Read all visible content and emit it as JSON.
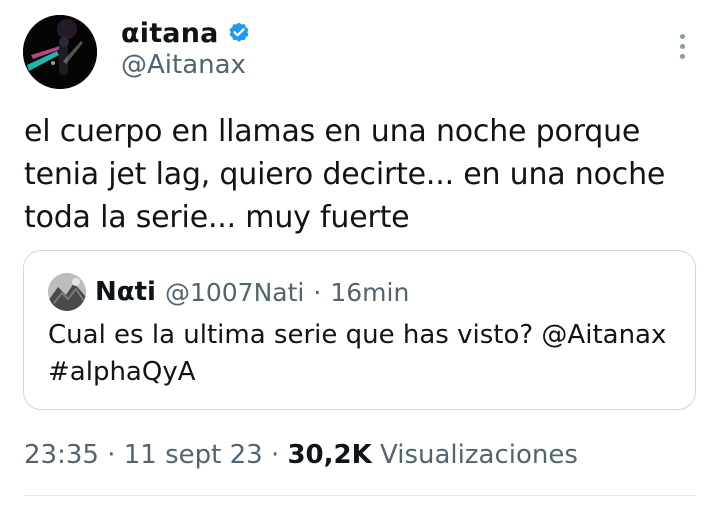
{
  "author": {
    "display_name": "αitana",
    "handle": "@Aitanax",
    "verified": true,
    "avatar_icon": "profile-photo"
  },
  "tweet": {
    "text": "el cuerpo en llamas en una noche porque tenia jet lag, quiero decirte... en una noche toda la serie... muy fuerte"
  },
  "quoted": {
    "display_name": "Nαti",
    "handle": "@1007Nati",
    "separator": "·",
    "time": "16min",
    "text_line1": "Cual es la ultima serie que has visto? @Aitanax",
    "text_line2": "#alphaQyA"
  },
  "meta": {
    "time": "23:35",
    "separator1": "·",
    "date": "11 sept 23",
    "separator2": "·",
    "views_count": "30,2K",
    "views_label": "Visualizaciones"
  },
  "colors": {
    "text": "#0f1419",
    "secondary": "#536471",
    "verified": "#1d9bf0",
    "border": "#cfd9de"
  },
  "icons": {
    "more": "more-vertical-icon",
    "verified": "verified-badge-icon"
  }
}
